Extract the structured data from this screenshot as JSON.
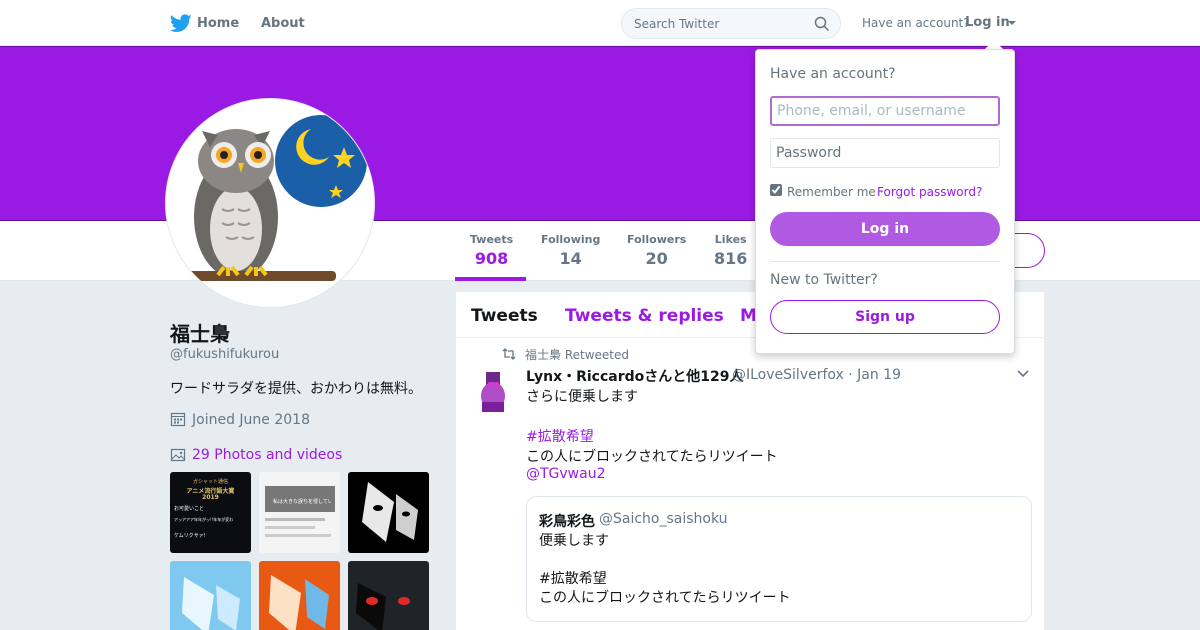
{
  "nav": {
    "home": "Home",
    "about": "About",
    "search_placeholder": "Search Twitter",
    "have_account": "Have an account?",
    "login": "Log in"
  },
  "colors": {
    "accent": "#9b1ae3",
    "banner": "#9b1ae3",
    "button": "#b05ae4"
  },
  "profile": {
    "name": "福士梟",
    "handle": "@fukushifukurou",
    "bio": "ワードサラダを提供、おかわりは無料。",
    "joined": "Joined June 2018",
    "photos": "29 Photos and videos"
  },
  "stats": [
    {
      "label": "Tweets",
      "value": "908"
    },
    {
      "label": "Following",
      "value": "14"
    },
    {
      "label": "Followers",
      "value": "20"
    },
    {
      "label": "Likes",
      "value": "816"
    }
  ],
  "thumbs": [
    {
      "lines": [
        "ガシャット通信",
        "アニメ流行語大賞",
        "2019",
        "お可愛いこと",
        "アッアアア年年がッ!!年年が変わ",
        "ケムリクサァ!"
      ]
    },
    {
      "lines": [
        "私は大きな誤ちを侵している"
      ]
    },
    {
      "lines": []
    },
    {
      "lines": []
    },
    {
      "lines": []
    },
    {
      "lines": []
    }
  ],
  "timeline": {
    "tabs": [
      "Tweets",
      "Tweets & replies",
      "M"
    ],
    "retweet_by": "福士梟 Retweeted",
    "tweet": {
      "author": "Lynx・Riccardoさんと他129人",
      "meta": "@ILoveSilverfox · Jan 19",
      "line1": "さらに便乗します",
      "hashtag": "#拡散希望",
      "line2": "この人にブロックされてたらリツイート",
      "mention": "@TGvwau2"
    },
    "quote": {
      "name": "彩鳥彩色",
      "handle": "@Saicho_saishoku",
      "line1": "便乗します",
      "line2": "#拡散希望",
      "line3": "この人にブロックされてたらリツイート"
    }
  },
  "login_dropdown": {
    "title": "Have an account?",
    "username_placeholder": "Phone, email, or username",
    "password_placeholder": "Password",
    "remember": "Remember me ·",
    "forgot": "Forgot password?",
    "login_button": "Log in",
    "new_to": "New to Twitter?",
    "signup_button": "Sign up"
  }
}
